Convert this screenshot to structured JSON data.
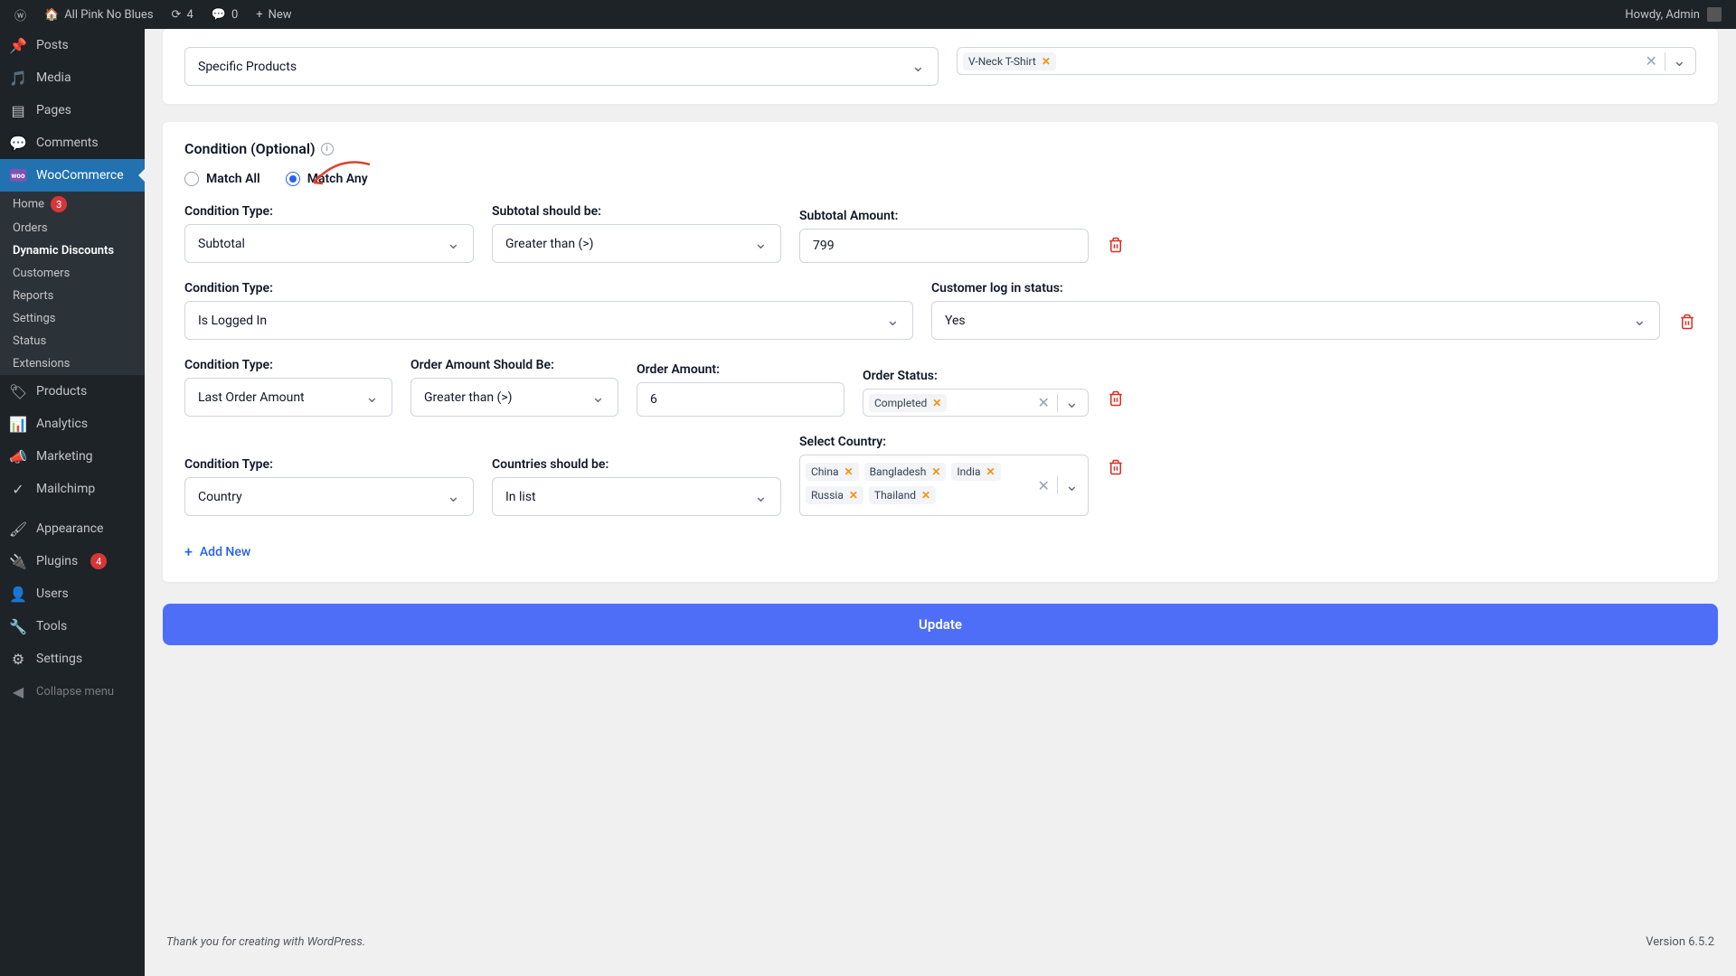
{
  "adminbar": {
    "site_name": "All Pink No Blues",
    "updates_count": "4",
    "comments_count": "0",
    "new_label": "New",
    "howdy": "Howdy, Admin"
  },
  "sidebar": {
    "posts": "Posts",
    "media": "Media",
    "pages": "Pages",
    "comments": "Comments",
    "woocommerce": "WooCommerce",
    "woo_sub": {
      "home": "Home",
      "home_badge": "3",
      "orders": "Orders",
      "dynamic_discounts": "Dynamic Discounts",
      "customers": "Customers",
      "reports": "Reports",
      "settings": "Settings",
      "status": "Status",
      "extensions": "Extensions"
    },
    "products": "Products",
    "analytics": "Analytics",
    "marketing": "Marketing",
    "mailchimp": "Mailchimp",
    "appearance": "Appearance",
    "plugins": "Plugins",
    "plugins_badge": "4",
    "users": "Users",
    "tools": "Tools",
    "settings": "Settings",
    "collapse": "Collapse menu"
  },
  "product_select": {
    "mode": "Specific Products",
    "tags": [
      "V-Neck T-Shirt"
    ]
  },
  "condition": {
    "title": "Condition (Optional)",
    "match_all": "Match All",
    "match_any": "Match Any",
    "rows": [
      {
        "type_label": "Condition Type:",
        "type_value": "Subtotal",
        "op_label": "Subtotal should be:",
        "op_value": "Greater than (>)",
        "amount_label": "Subtotal Amount:",
        "amount_value": "799"
      },
      {
        "type_label": "Condition Type:",
        "type_value": "Is Logged In",
        "status_label": "Customer log in status:",
        "status_value": "Yes"
      },
      {
        "type_label": "Condition Type:",
        "type_value": "Last Order Amount",
        "op_label": "Order Amount Should Be:",
        "op_value": "Greater than (>)",
        "amount_label": "Order Amount:",
        "amount_value": "6",
        "status_label": "Order Status:",
        "status_tags": [
          "Completed"
        ]
      },
      {
        "type_label": "Condition Type:",
        "type_value": "Country",
        "op_label": "Countries should be:",
        "op_value": "In list",
        "country_label": "Select Country:",
        "country_tags": [
          "China",
          "Bangladesh",
          "India",
          "Russia",
          "Thailand"
        ]
      }
    ],
    "add_new": "Add New",
    "update": "Update"
  },
  "footer": {
    "thanks": "Thank you for creating with WordPress.",
    "version": "Version 6.5.2"
  }
}
